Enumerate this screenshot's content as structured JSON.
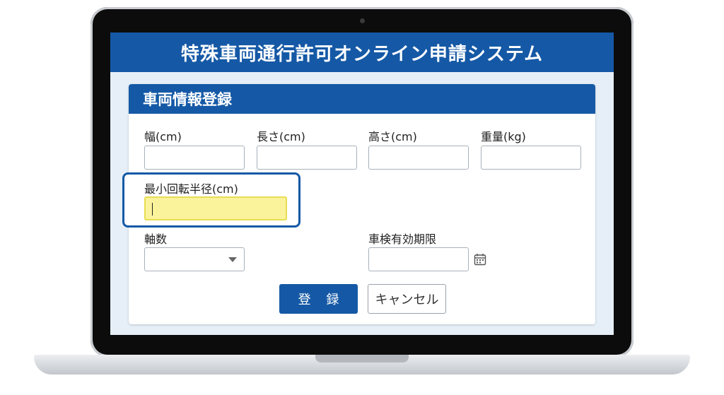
{
  "app": {
    "title": "特殊車両通行許可オンライン申請システム"
  },
  "form": {
    "section_title": "車両情報登録",
    "fields": {
      "width": {
        "label": "幅(cm)",
        "value": ""
      },
      "length": {
        "label": "長さ(cm)",
        "value": ""
      },
      "height": {
        "label": "高さ(cm)",
        "value": ""
      },
      "weight": {
        "label": "重量(kg)",
        "value": ""
      },
      "min_turning_radius": {
        "label": "最小回転半径(cm)",
        "value": "",
        "focused": true
      },
      "axles": {
        "label": "軸数",
        "selected": ""
      },
      "inspection_expiry": {
        "label": "車検有効期限",
        "value": ""
      }
    },
    "buttons": {
      "submit": "登 録",
      "cancel": "キャンセル"
    }
  },
  "icons": {
    "select": "chevron-down-icon",
    "date": "calendar-icon"
  },
  "colors": {
    "brand_blue": "#1559a6",
    "focus_fill": "#fbf39c"
  }
}
